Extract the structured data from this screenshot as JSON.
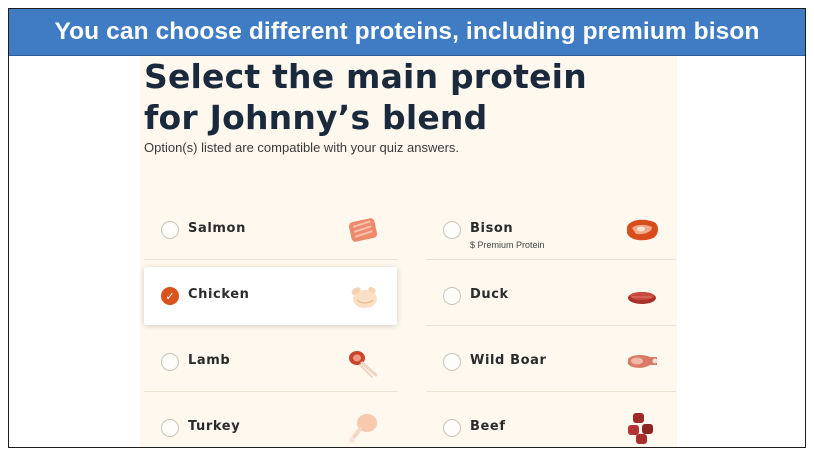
{
  "banner": {
    "caption": "You can choose different proteins, including premium bison",
    "background_color": "#3f7cc4"
  },
  "page": {
    "title_line1": "Select the main protein",
    "title_line2": "for Johnny’s blend",
    "subtitle": "Option(s) listed are compatible with your quiz answers."
  },
  "theme": {
    "accent_color": "#d9531e",
    "panel_background": "#fef8ee"
  },
  "options": [
    {
      "label": "Salmon",
      "sub": "",
      "icon": "salmon-icon",
      "selected": false
    },
    {
      "label": "Bison",
      "sub": "$ Premium Protein",
      "icon": "bison-icon",
      "selected": false
    },
    {
      "label": "Chicken",
      "sub": "",
      "icon": "chicken-icon",
      "selected": true
    },
    {
      "label": "Duck",
      "sub": "",
      "icon": "duck-icon",
      "selected": false
    },
    {
      "label": "Lamb",
      "sub": "",
      "icon": "lamb-icon",
      "selected": false
    },
    {
      "label": "Wild Boar",
      "sub": "",
      "icon": "wild-boar-icon",
      "selected": false
    },
    {
      "label": "Turkey",
      "sub": "",
      "icon": "turkey-icon",
      "selected": false
    },
    {
      "label": "Beef",
      "sub": "",
      "icon": "beef-icon",
      "selected": false
    }
  ]
}
